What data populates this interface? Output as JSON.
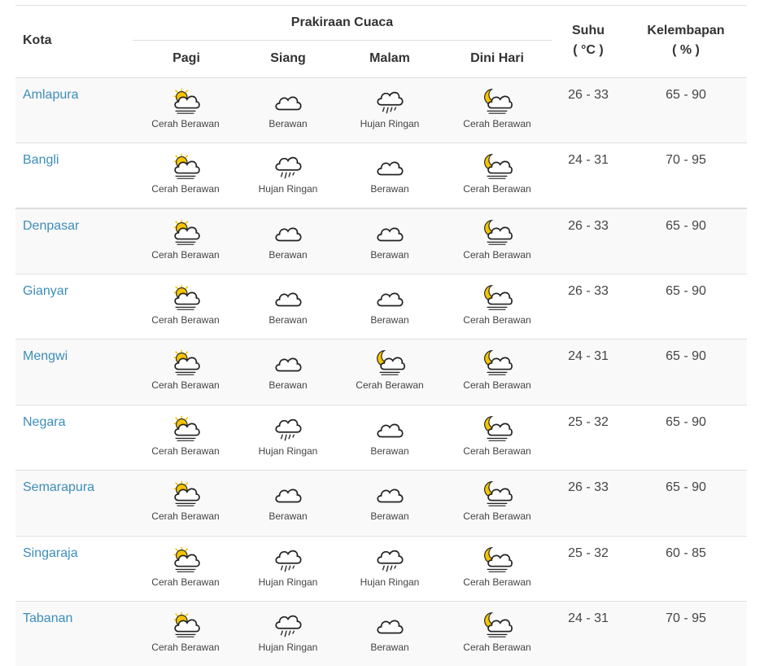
{
  "header": {
    "kota": "Kota",
    "prakiraan": "Prakiraan Cuaca",
    "periods": [
      "Pagi",
      "Siang",
      "Malam",
      "Dini Hari"
    ],
    "suhu": "Suhu",
    "suhu_unit": "( °C )",
    "kelembapan": "Kelembapan",
    "kelembapan_unit": "( % )"
  },
  "rows": [
    {
      "city": "Amlapura",
      "forecast": [
        {
          "icon": "sun-cloud-icon",
          "label": "Cerah Berawan"
        },
        {
          "icon": "cloud-icon",
          "label": "Berawan"
        },
        {
          "icon": "rain-cloud-icon",
          "label": "Hujan Ringan"
        },
        {
          "icon": "moon-cloud-icon",
          "label": "Cerah Berawan"
        }
      ],
      "temp": "26 - 33",
      "humidity": "65 - 90"
    },
    {
      "city": "Bangli",
      "forecast": [
        {
          "icon": "sun-cloud-icon",
          "label": "Cerah Berawan"
        },
        {
          "icon": "rain-cloud-icon",
          "label": "Hujan Ringan"
        },
        {
          "icon": "cloud-icon",
          "label": "Berawan"
        },
        {
          "icon": "moon-cloud-icon",
          "label": "Cerah Berawan"
        }
      ],
      "temp": "24 - 31",
      "humidity": "70 - 95"
    },
    {
      "city": "Denpasar",
      "forecast": [
        {
          "icon": "sun-cloud-icon",
          "label": "Cerah Berawan"
        },
        {
          "icon": "cloud-icon",
          "label": "Berawan"
        },
        {
          "icon": "cloud-icon",
          "label": "Berawan"
        },
        {
          "icon": "moon-cloud-icon",
          "label": "Cerah Berawan"
        }
      ],
      "temp": "26 - 33",
      "humidity": "65 - 90"
    },
    {
      "city": "Gianyar",
      "forecast": [
        {
          "icon": "sun-cloud-icon",
          "label": "Cerah Berawan"
        },
        {
          "icon": "cloud-icon",
          "label": "Berawan"
        },
        {
          "icon": "cloud-icon",
          "label": "Berawan"
        },
        {
          "icon": "moon-cloud-icon",
          "label": "Cerah Berawan"
        }
      ],
      "temp": "26 - 33",
      "humidity": "65 - 90"
    },
    {
      "city": "Mengwi",
      "forecast": [
        {
          "icon": "sun-cloud-icon",
          "label": "Cerah Berawan"
        },
        {
          "icon": "cloud-icon",
          "label": "Berawan"
        },
        {
          "icon": "moon-cloud-icon",
          "label": "Cerah Berawan"
        },
        {
          "icon": "moon-cloud-icon",
          "label": "Cerah Berawan"
        }
      ],
      "temp": "24 - 31",
      "humidity": "65 - 90"
    },
    {
      "city": "Negara",
      "forecast": [
        {
          "icon": "sun-cloud-icon",
          "label": "Cerah Berawan"
        },
        {
          "icon": "rain-cloud-icon",
          "label": "Hujan Ringan"
        },
        {
          "icon": "cloud-icon",
          "label": "Berawan"
        },
        {
          "icon": "moon-cloud-icon",
          "label": "Cerah Berawan"
        }
      ],
      "temp": "25 - 32",
      "humidity": "65 - 90"
    },
    {
      "city": "Semarapura",
      "forecast": [
        {
          "icon": "sun-cloud-icon",
          "label": "Cerah Berawan"
        },
        {
          "icon": "cloud-icon",
          "label": "Berawan"
        },
        {
          "icon": "cloud-icon",
          "label": "Berawan"
        },
        {
          "icon": "moon-cloud-icon",
          "label": "Cerah Berawan"
        }
      ],
      "temp": "26 - 33",
      "humidity": "65 - 90"
    },
    {
      "city": "Singaraja",
      "forecast": [
        {
          "icon": "sun-cloud-icon",
          "label": "Cerah Berawan"
        },
        {
          "icon": "rain-cloud-icon",
          "label": "Hujan Ringan"
        },
        {
          "icon": "rain-cloud-icon",
          "label": "Hujan Ringan"
        },
        {
          "icon": "moon-cloud-icon",
          "label": "Cerah Berawan"
        }
      ],
      "temp": "25 - 32",
      "humidity": "60 - 85"
    },
    {
      "city": "Tabanan",
      "forecast": [
        {
          "icon": "sun-cloud-icon",
          "label": "Cerah Berawan"
        },
        {
          "icon": "rain-cloud-icon",
          "label": "Hujan Ringan"
        },
        {
          "icon": "cloud-icon",
          "label": "Berawan"
        },
        {
          "icon": "moon-cloud-icon",
          "label": "Cerah Berawan"
        }
      ],
      "temp": "24 - 31",
      "humidity": "70 - 95"
    }
  ],
  "colors": {
    "link": "#3c8dbc",
    "sun": "#f5c400",
    "border": "#dddddd",
    "stripe": "#f9f9f9"
  }
}
